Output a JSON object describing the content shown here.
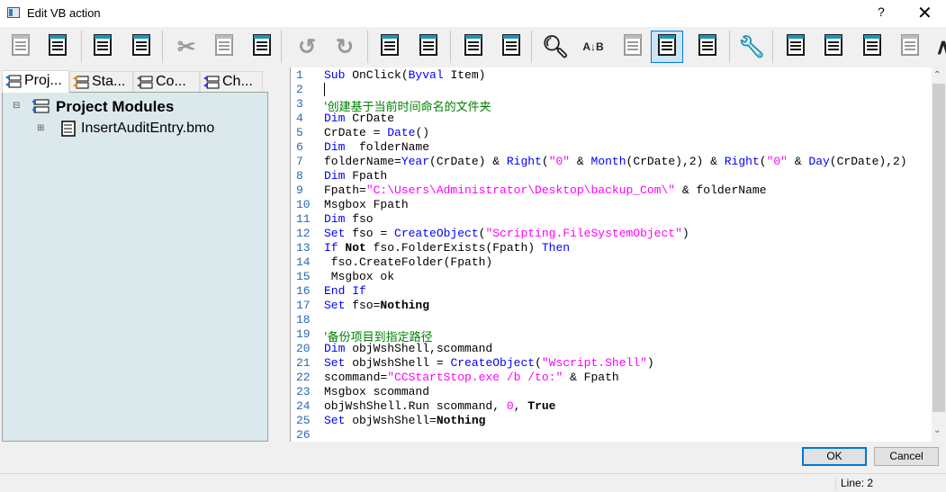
{
  "window": {
    "title": "Edit VB action",
    "help": "?",
    "close": "✕"
  },
  "toolbar": {
    "buttons": [
      {
        "name": "properties-icon",
        "active": false
      },
      {
        "name": "document-icon",
        "active": false
      },
      {
        "name": "print-icon",
        "active": false
      },
      {
        "name": "print-preview-icon",
        "active": false
      },
      {
        "name": "cut-icon",
        "active": false
      },
      {
        "name": "copy-icon",
        "active": false
      },
      {
        "name": "paste-icon",
        "active": false
      },
      {
        "name": "undo-icon",
        "active": false
      },
      {
        "name": "redo-icon",
        "active": false
      },
      {
        "name": "indent-icon",
        "active": false
      },
      {
        "name": "outdent-icon",
        "active": false
      },
      {
        "name": "comment-icon",
        "active": false
      },
      {
        "name": "uncomment-icon",
        "active": false
      },
      {
        "name": "find-icon",
        "active": false
      },
      {
        "name": "replace-icon",
        "active": false
      },
      {
        "name": "find-next-icon",
        "active": false
      },
      {
        "name": "line-numbers-icon",
        "active": true
      },
      {
        "name": "goto-line-icon",
        "active": false
      },
      {
        "name": "settings-wrench-icon",
        "active": false
      },
      {
        "name": "run-icon",
        "active": false
      },
      {
        "name": "object-tree-icon",
        "active": false
      },
      {
        "name": "object-tree-code-icon",
        "active": false
      },
      {
        "name": "pt-tree-icon",
        "active": false
      },
      {
        "name": "compass-icon",
        "active": false
      }
    ]
  },
  "left_panel": {
    "tabs": [
      {
        "label": "Proj...",
        "color": "#1f6fd1"
      },
      {
        "label": "Sta...",
        "color": "#e88a00"
      },
      {
        "label": "Co...",
        "color": "#555555"
      },
      {
        "label": "Ch...",
        "color": "#3a3ad0"
      }
    ],
    "tree": {
      "root": "Project Modules",
      "children": [
        "InsertAuditEntry.bmo"
      ]
    }
  },
  "editor": {
    "lines": [
      [
        [
          "kw",
          "Sub"
        ],
        [
          "tx",
          " OnClick("
        ],
        [
          "kw",
          "Byval"
        ],
        [
          "tx",
          " Item)"
        ]
      ],
      [],
      [
        [
          "cm",
          "'创建基于当前时间命名的文件夹"
        ]
      ],
      [
        [
          "kw",
          "Dim"
        ],
        [
          "tx",
          " CrDate"
        ]
      ],
      [
        [
          "tx",
          "CrDate = "
        ],
        [
          "kw",
          "Date"
        ],
        [
          "tx",
          "()"
        ]
      ],
      [
        [
          "kw",
          "Dim"
        ],
        [
          "tx",
          "  folderName"
        ]
      ],
      [
        [
          "tx",
          "folderName="
        ],
        [
          "kw",
          "Year"
        ],
        [
          "tx",
          "(CrDate) & "
        ],
        [
          "kw",
          "Right"
        ],
        [
          "tx",
          "("
        ],
        [
          "str",
          "\"0\""
        ],
        [
          "tx",
          " & "
        ],
        [
          "kw",
          "Month"
        ],
        [
          "tx",
          "(CrDate),2) & "
        ],
        [
          "kw",
          "Right"
        ],
        [
          "tx",
          "("
        ],
        [
          "str",
          "\"0\""
        ],
        [
          "tx",
          " & "
        ],
        [
          "kw",
          "Day"
        ],
        [
          "tx",
          "(CrDate),2)"
        ]
      ],
      [
        [
          "kw",
          "Dim"
        ],
        [
          "tx",
          " Fpath"
        ]
      ],
      [
        [
          "tx",
          "Fpath="
        ],
        [
          "str",
          "\"C:\\Users\\Administrator\\Desktop\\backup_Com\\\""
        ],
        [
          "tx",
          " & folderName"
        ]
      ],
      [
        [
          "tx",
          "Msgbox Fpath"
        ]
      ],
      [
        [
          "kw",
          "Dim"
        ],
        [
          "tx",
          " fso"
        ]
      ],
      [
        [
          "kw",
          "Set"
        ],
        [
          "tx",
          " fso = "
        ],
        [
          "kw",
          "CreateObject"
        ],
        [
          "tx",
          "("
        ],
        [
          "str",
          "\"Scripting.FileSystemObject\""
        ],
        [
          "tx",
          ")"
        ]
      ],
      [
        [
          "kw",
          "If"
        ],
        [
          "tx",
          " "
        ],
        [
          "bd",
          "Not"
        ],
        [
          "tx",
          " fso.FolderExists(Fpath) "
        ],
        [
          "kw",
          "Then"
        ]
      ],
      [
        [
          "tx",
          " fso.CreateFolder(Fpath)"
        ]
      ],
      [
        [
          "tx",
          " Msgbox ok"
        ]
      ],
      [
        [
          "kw",
          "End If"
        ]
      ],
      [
        [
          "kw",
          "Set"
        ],
        [
          "tx",
          " fso="
        ],
        [
          "bd",
          "Nothing"
        ]
      ],
      [],
      [
        [
          "cm",
          "'备份项目到指定路径"
        ]
      ],
      [
        [
          "kw",
          "Dim"
        ],
        [
          "tx",
          " objWshShell,scommand"
        ]
      ],
      [
        [
          "kw",
          "Set"
        ],
        [
          "tx",
          " objWshShell = "
        ],
        [
          "kw",
          "CreateObject"
        ],
        [
          "tx",
          "("
        ],
        [
          "str",
          "\"Wscript.Shell\""
        ],
        [
          "tx",
          ")"
        ]
      ],
      [
        [
          "tx",
          "scommand="
        ],
        [
          "str",
          "\"CCStartStop.exe /b /to:\""
        ],
        [
          "tx",
          " & Fpath"
        ]
      ],
      [
        [
          "tx",
          "Msgbox scommand"
        ]
      ],
      [
        [
          "tx",
          "objWshShell.Run scommand, "
        ],
        [
          "str",
          "0"
        ],
        [
          "tx",
          ", "
        ],
        [
          "bd",
          "True"
        ]
      ],
      [
        [
          "kw",
          "Set"
        ],
        [
          "tx",
          " objWshShell="
        ],
        [
          "bd",
          "Nothing"
        ]
      ],
      []
    ]
  },
  "buttons": {
    "ok": "OK",
    "cancel": "Cancel"
  },
  "status": {
    "line": "Line: 2"
  }
}
